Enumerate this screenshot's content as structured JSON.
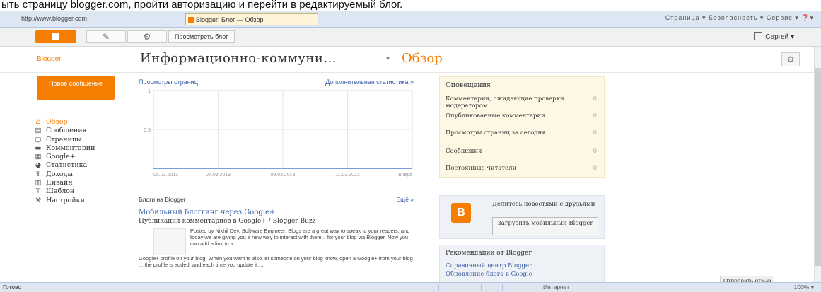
{
  "caption": "ыть страницу blogger.com, пройти авторизацию и перейти в редактируемый блог.",
  "browser": {
    "address": "http://www.blogger.com",
    "active_tab": "Blogger: Блог — Обзор",
    "toolbar_right": "Страница ▾  Безопасность ▾  Сервис ▾  ❓▾"
  },
  "blogger_bar": {
    "view_blog": "Просмотреть блог",
    "pen_icon": "✎",
    "gear_icon": "⚙",
    "user": "Сергей ▾"
  },
  "header": {
    "brand": "Blogger",
    "blog_title": "Информационно-коммуни...",
    "caret": "▾",
    "section": "Обзор",
    "settings_icon": "⚙"
  },
  "sidebar": {
    "new_post_label": "Новое сообщение",
    "items": [
      {
        "label": "Обзор",
        "icon": "home-icon",
        "glyph": "⌂"
      },
      {
        "label": "Сообщения",
        "icon": "posts-icon",
        "glyph": "▤"
      },
      {
        "label": "Страницы",
        "icon": "pages-icon",
        "glyph": "▢"
      },
      {
        "label": "Комментарии",
        "icon": "comments-icon",
        "glyph": "▬"
      },
      {
        "label": "Google+",
        "icon": "google-plus-icon",
        "glyph": "▦"
      },
      {
        "label": "Статистика",
        "icon": "stats-icon",
        "glyph": "◕"
      },
      {
        "label": "Доходы",
        "icon": "earnings-icon",
        "glyph": "₮"
      },
      {
        "label": "Дизайн",
        "icon": "layout-icon",
        "glyph": "▥"
      },
      {
        "label": "Шаблон",
        "icon": "template-icon",
        "glyph": "⊤"
      },
      {
        "label": "Настройки",
        "icon": "settings-icon",
        "glyph": "⚒"
      }
    ]
  },
  "stats": {
    "title": "Просмотры страниц",
    "link": "Дополнительная статистика »",
    "y_ticks": [
      "1",
      "0,5"
    ],
    "x_ticks": [
      "05.03.2013",
      "07.03.2013",
      "09.03.2013",
      "11.03.2013",
      "Вчера"
    ]
  },
  "chart_data": {
    "type": "line",
    "title": "Просмотры страниц",
    "xlabel": "",
    "ylabel": "",
    "categories": [
      "05.03.2013",
      "07.03.2013",
      "09.03.2013",
      "11.03.2013",
      "Вчера"
    ],
    "values": [
      0,
      0,
      0,
      0,
      0
    ],
    "ylim": [
      0,
      1
    ],
    "grid": true
  },
  "feed": {
    "title": "Блоги на Blogger",
    "more": "Ещё »",
    "post_title": "Мобильный блоггинг через Google+",
    "post_subtitle": "Публикация комментариев в Google+ / Blogger Buzz",
    "post_body": "Posted by Nikhil Dev, Software Engineer. Blogs are a great way to speak to your readers, and today we are giving you a new way to interact with them... for your blog via Blogger. Now you can add a link to a",
    "post_body2": "Google+ profile on your blog. When you want to also let someone on your blog know, open a Google+ from your blog ... the profile is added, and each time you update it, ..."
  },
  "alerts": {
    "title": "Оповещения",
    "rows": [
      {
        "label": "Комментарии, ожидающие проверки модератором",
        "count": "0"
      },
      {
        "label": "Опубликованные комментарии",
        "count": "0"
      },
      {
        "label": "Просмотры страниц за сегодня",
        "count": "0"
      },
      {
        "label": "Сообщения",
        "count": "0"
      },
      {
        "label": "Постоянные читатели",
        "count": "0"
      }
    ]
  },
  "promo": {
    "text": "Делитесь новостями с друзьями",
    "button": "Загрузить мобильный Blogger"
  },
  "recommendations": {
    "title": "Рекомендации от Blogger",
    "links": [
      "Справочный центр Blogger",
      "Обновление блога в Google"
    ]
  },
  "feedback": "Отправить отзыв",
  "statusbar": {
    "left": "Готово",
    "middle": "Интернет",
    "zoom": "100% ▾"
  }
}
